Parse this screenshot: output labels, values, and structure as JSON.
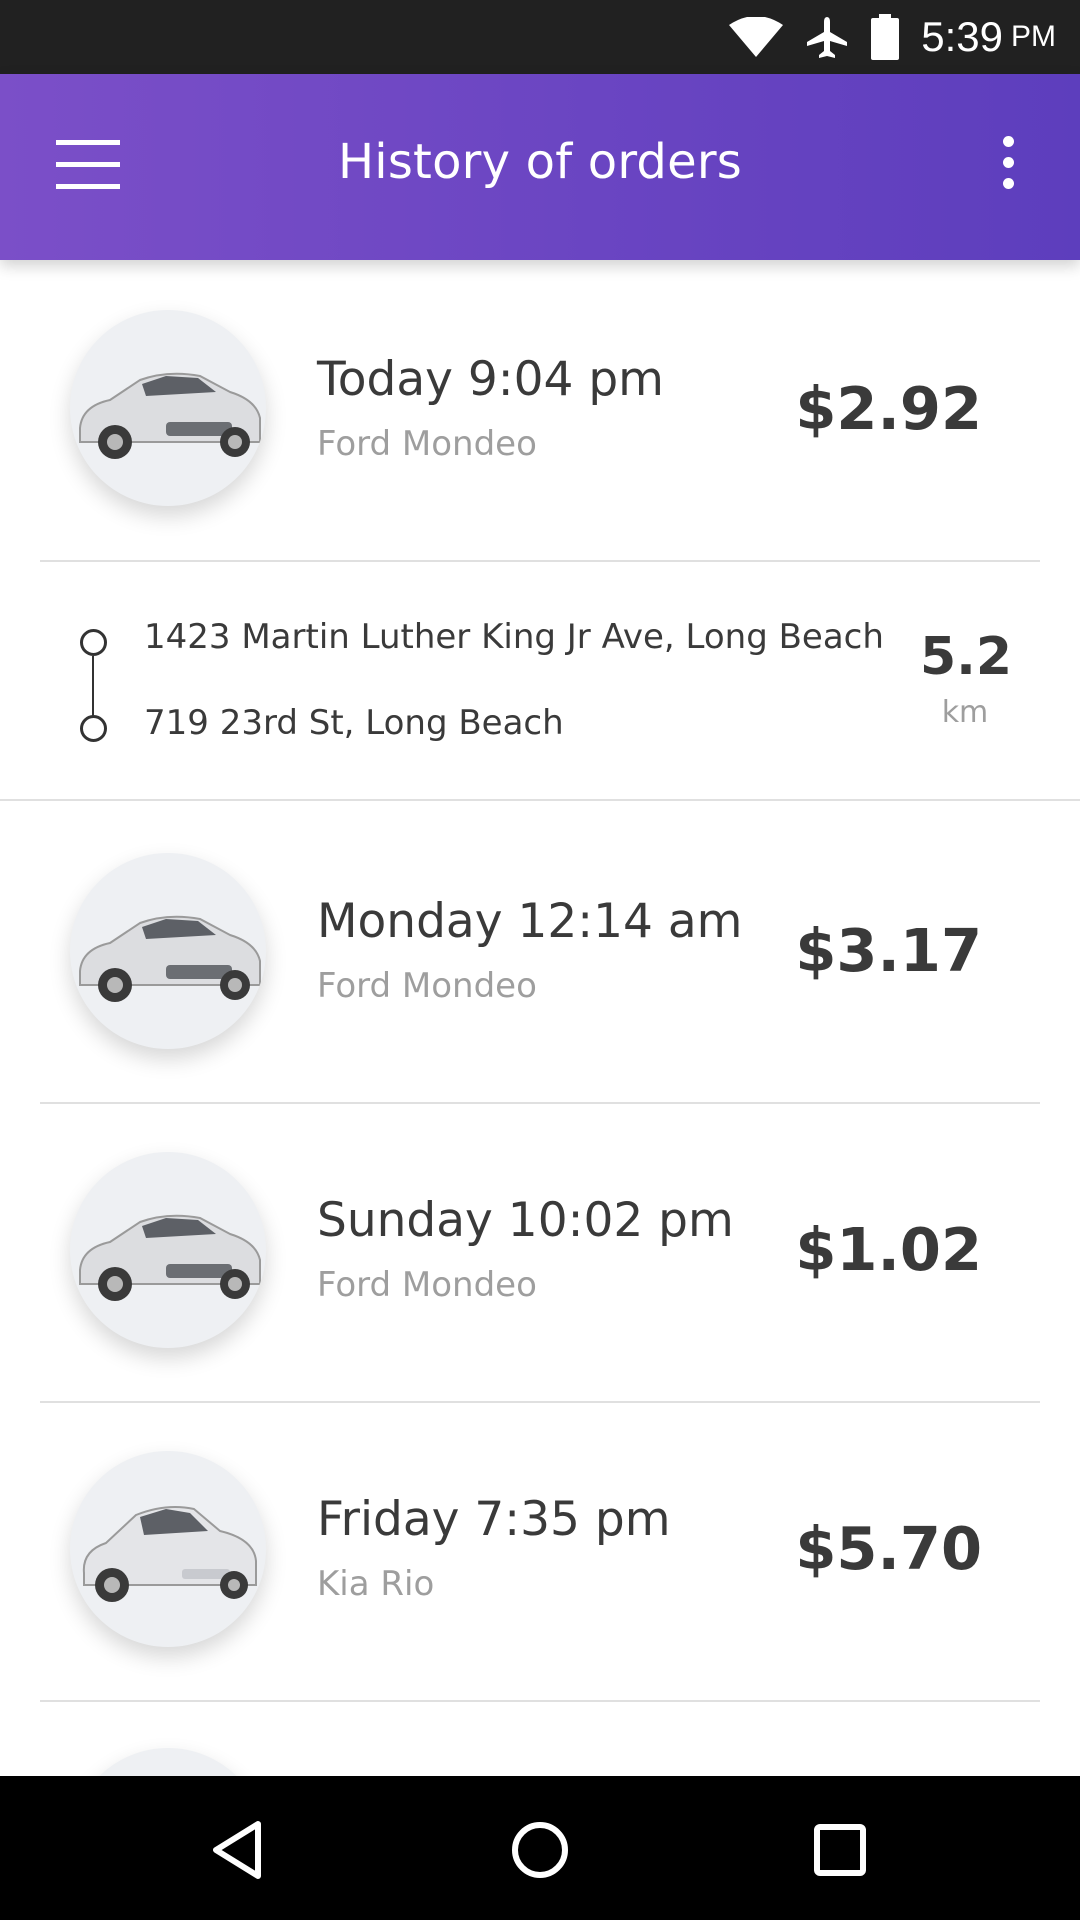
{
  "status_bar": {
    "time": "5:39",
    "ampm": "PM",
    "icons": [
      "wifi-icon",
      "airplane-icon",
      "battery-icon"
    ]
  },
  "app_bar": {
    "title": "History of orders",
    "menu_icon": "hamburger-menu-icon",
    "more_icon": "more-vertical-icon",
    "gradient": [
      "#7b4fc8",
      "#5d3ebd"
    ]
  },
  "orders": [
    {
      "time": "Today 9:04 pm",
      "model": "Ford Mondeo",
      "price": "$2.92"
    },
    {
      "time": "Monday 12:14 am",
      "model": "Ford Mondeo",
      "price": "$3.17"
    },
    {
      "time": "Sunday 10:02 pm",
      "model": "Ford Mondeo",
      "price": "$1.02"
    },
    {
      "time": "Friday 7:35 pm",
      "model": "Kia Rio",
      "price": "$5.70"
    }
  ],
  "route": {
    "from": "1423 Martin Luther King Jr Ave, Long Beach",
    "to": "719 23rd St, Long Beach",
    "distance": "5.2",
    "unit": "km"
  },
  "nav_bar": {
    "icons": [
      "back-icon",
      "home-icon",
      "recents-icon"
    ]
  }
}
